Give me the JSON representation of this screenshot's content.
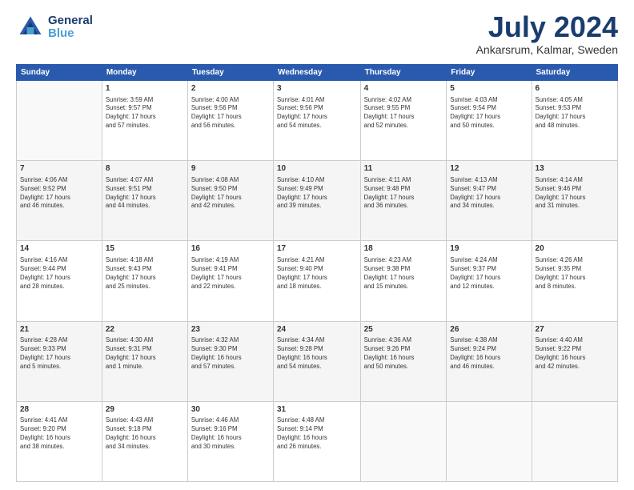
{
  "logo": {
    "line1": "General",
    "line2": "Blue"
  },
  "title": "July 2024",
  "subtitle": "Ankarsrum, Kalmar, Sweden",
  "headers": [
    "Sunday",
    "Monday",
    "Tuesday",
    "Wednesday",
    "Thursday",
    "Friday",
    "Saturday"
  ],
  "weeks": [
    [
      {
        "num": "",
        "info": ""
      },
      {
        "num": "1",
        "info": "Sunrise: 3:59 AM\nSunset: 9:57 PM\nDaylight: 17 hours\nand 57 minutes."
      },
      {
        "num": "2",
        "info": "Sunrise: 4:00 AM\nSunset: 9:56 PM\nDaylight: 17 hours\nand 56 minutes."
      },
      {
        "num": "3",
        "info": "Sunrise: 4:01 AM\nSunset: 9:56 PM\nDaylight: 17 hours\nand 54 minutes."
      },
      {
        "num": "4",
        "info": "Sunrise: 4:02 AM\nSunset: 9:55 PM\nDaylight: 17 hours\nand 52 minutes."
      },
      {
        "num": "5",
        "info": "Sunrise: 4:03 AM\nSunset: 9:54 PM\nDaylight: 17 hours\nand 50 minutes."
      },
      {
        "num": "6",
        "info": "Sunrise: 4:05 AM\nSunset: 9:53 PM\nDaylight: 17 hours\nand 48 minutes."
      }
    ],
    [
      {
        "num": "7",
        "info": "Sunrise: 4:06 AM\nSunset: 9:52 PM\nDaylight: 17 hours\nand 46 minutes."
      },
      {
        "num": "8",
        "info": "Sunrise: 4:07 AM\nSunset: 9:51 PM\nDaylight: 17 hours\nand 44 minutes."
      },
      {
        "num": "9",
        "info": "Sunrise: 4:08 AM\nSunset: 9:50 PM\nDaylight: 17 hours\nand 42 minutes."
      },
      {
        "num": "10",
        "info": "Sunrise: 4:10 AM\nSunset: 9:49 PM\nDaylight: 17 hours\nand 39 minutes."
      },
      {
        "num": "11",
        "info": "Sunrise: 4:11 AM\nSunset: 9:48 PM\nDaylight: 17 hours\nand 36 minutes."
      },
      {
        "num": "12",
        "info": "Sunrise: 4:13 AM\nSunset: 9:47 PM\nDaylight: 17 hours\nand 34 minutes."
      },
      {
        "num": "13",
        "info": "Sunrise: 4:14 AM\nSunset: 9:46 PM\nDaylight: 17 hours\nand 31 minutes."
      }
    ],
    [
      {
        "num": "14",
        "info": "Sunrise: 4:16 AM\nSunset: 9:44 PM\nDaylight: 17 hours\nand 28 minutes."
      },
      {
        "num": "15",
        "info": "Sunrise: 4:18 AM\nSunset: 9:43 PM\nDaylight: 17 hours\nand 25 minutes."
      },
      {
        "num": "16",
        "info": "Sunrise: 4:19 AM\nSunset: 9:41 PM\nDaylight: 17 hours\nand 22 minutes."
      },
      {
        "num": "17",
        "info": "Sunrise: 4:21 AM\nSunset: 9:40 PM\nDaylight: 17 hours\nand 18 minutes."
      },
      {
        "num": "18",
        "info": "Sunrise: 4:23 AM\nSunset: 9:38 PM\nDaylight: 17 hours\nand 15 minutes."
      },
      {
        "num": "19",
        "info": "Sunrise: 4:24 AM\nSunset: 9:37 PM\nDaylight: 17 hours\nand 12 minutes."
      },
      {
        "num": "20",
        "info": "Sunrise: 4:26 AM\nSunset: 9:35 PM\nDaylight: 17 hours\nand 8 minutes."
      }
    ],
    [
      {
        "num": "21",
        "info": "Sunrise: 4:28 AM\nSunset: 9:33 PM\nDaylight: 17 hours\nand 5 minutes."
      },
      {
        "num": "22",
        "info": "Sunrise: 4:30 AM\nSunset: 9:31 PM\nDaylight: 17 hours\nand 1 minute."
      },
      {
        "num": "23",
        "info": "Sunrise: 4:32 AM\nSunset: 9:30 PM\nDaylight: 16 hours\nand 57 minutes."
      },
      {
        "num": "24",
        "info": "Sunrise: 4:34 AM\nSunset: 9:28 PM\nDaylight: 16 hours\nand 54 minutes."
      },
      {
        "num": "25",
        "info": "Sunrise: 4:36 AM\nSunset: 9:26 PM\nDaylight: 16 hours\nand 50 minutes."
      },
      {
        "num": "26",
        "info": "Sunrise: 4:38 AM\nSunset: 9:24 PM\nDaylight: 16 hours\nand 46 minutes."
      },
      {
        "num": "27",
        "info": "Sunrise: 4:40 AM\nSunset: 9:22 PM\nDaylight: 16 hours\nand 42 minutes."
      }
    ],
    [
      {
        "num": "28",
        "info": "Sunrise: 4:41 AM\nSunset: 9:20 PM\nDaylight: 16 hours\nand 38 minutes."
      },
      {
        "num": "29",
        "info": "Sunrise: 4:43 AM\nSunset: 9:18 PM\nDaylight: 16 hours\nand 34 minutes."
      },
      {
        "num": "30",
        "info": "Sunrise: 4:46 AM\nSunset: 9:16 PM\nDaylight: 16 hours\nand 30 minutes."
      },
      {
        "num": "31",
        "info": "Sunrise: 4:48 AM\nSunset: 9:14 PM\nDaylight: 16 hours\nand 26 minutes."
      },
      {
        "num": "",
        "info": ""
      },
      {
        "num": "",
        "info": ""
      },
      {
        "num": "",
        "info": ""
      }
    ]
  ]
}
